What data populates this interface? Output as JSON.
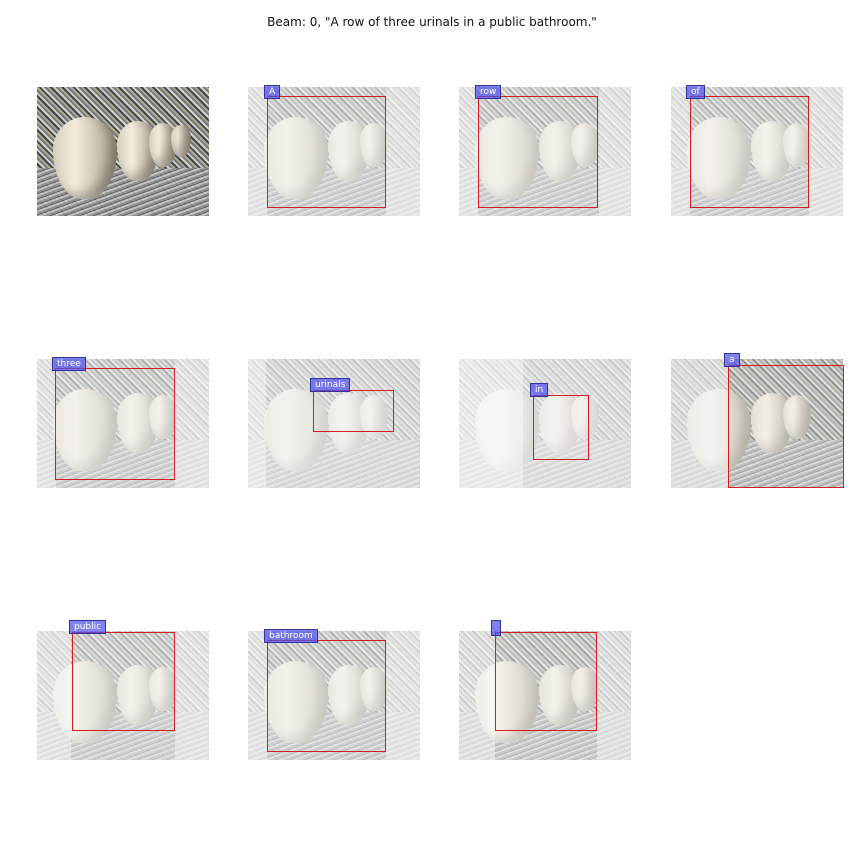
{
  "title": "Beam: 0, \"A row of three urinals in a public bathroom.\"",
  "words": [
    "A",
    "row",
    "of",
    "three",
    "urinals",
    "in",
    "a",
    "public",
    "bathroom",
    ""
  ],
  "colors": {
    "box": "#d21f1f",
    "tag": "#5050f0"
  }
}
